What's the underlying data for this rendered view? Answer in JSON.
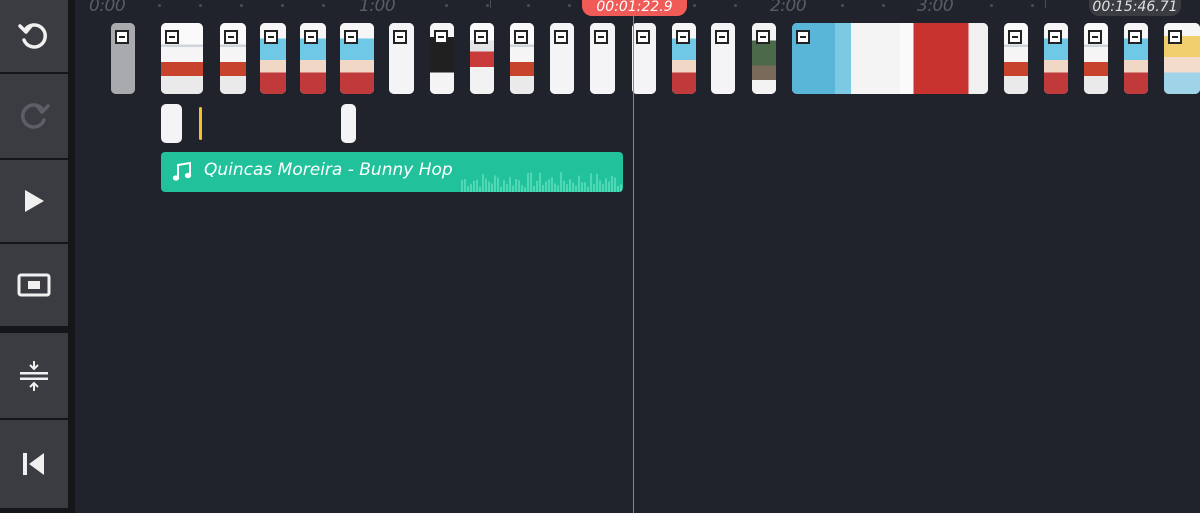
{
  "toolbar": {
    "items": [
      {
        "name": "undo",
        "icon": "undo-icon"
      },
      {
        "name": "redo",
        "icon": "redo-icon"
      },
      {
        "name": "play",
        "icon": "play-icon"
      },
      {
        "name": "preview",
        "icon": "preview-icon"
      },
      {
        "name": "zoom",
        "icon": "zoom-fit-icon"
      },
      {
        "name": "skip-to-start",
        "icon": "skip-to-start-icon"
      }
    ]
  },
  "ruler": {
    "labels": [
      "0:00",
      "1:00",
      "2:00",
      "3:00"
    ]
  },
  "playhead": {
    "time": "00:01:22.9"
  },
  "duration": {
    "time": "00:15:46.71"
  },
  "audio": {
    "title": "Quincas Moreira - Bunny Hop",
    "icon": "music-note-icon"
  },
  "colors": {
    "accent": "#f15b57",
    "audio": "#21c29b",
    "marker": "#f2c230",
    "panel": "#3a3c42",
    "background": "#20232b"
  }
}
